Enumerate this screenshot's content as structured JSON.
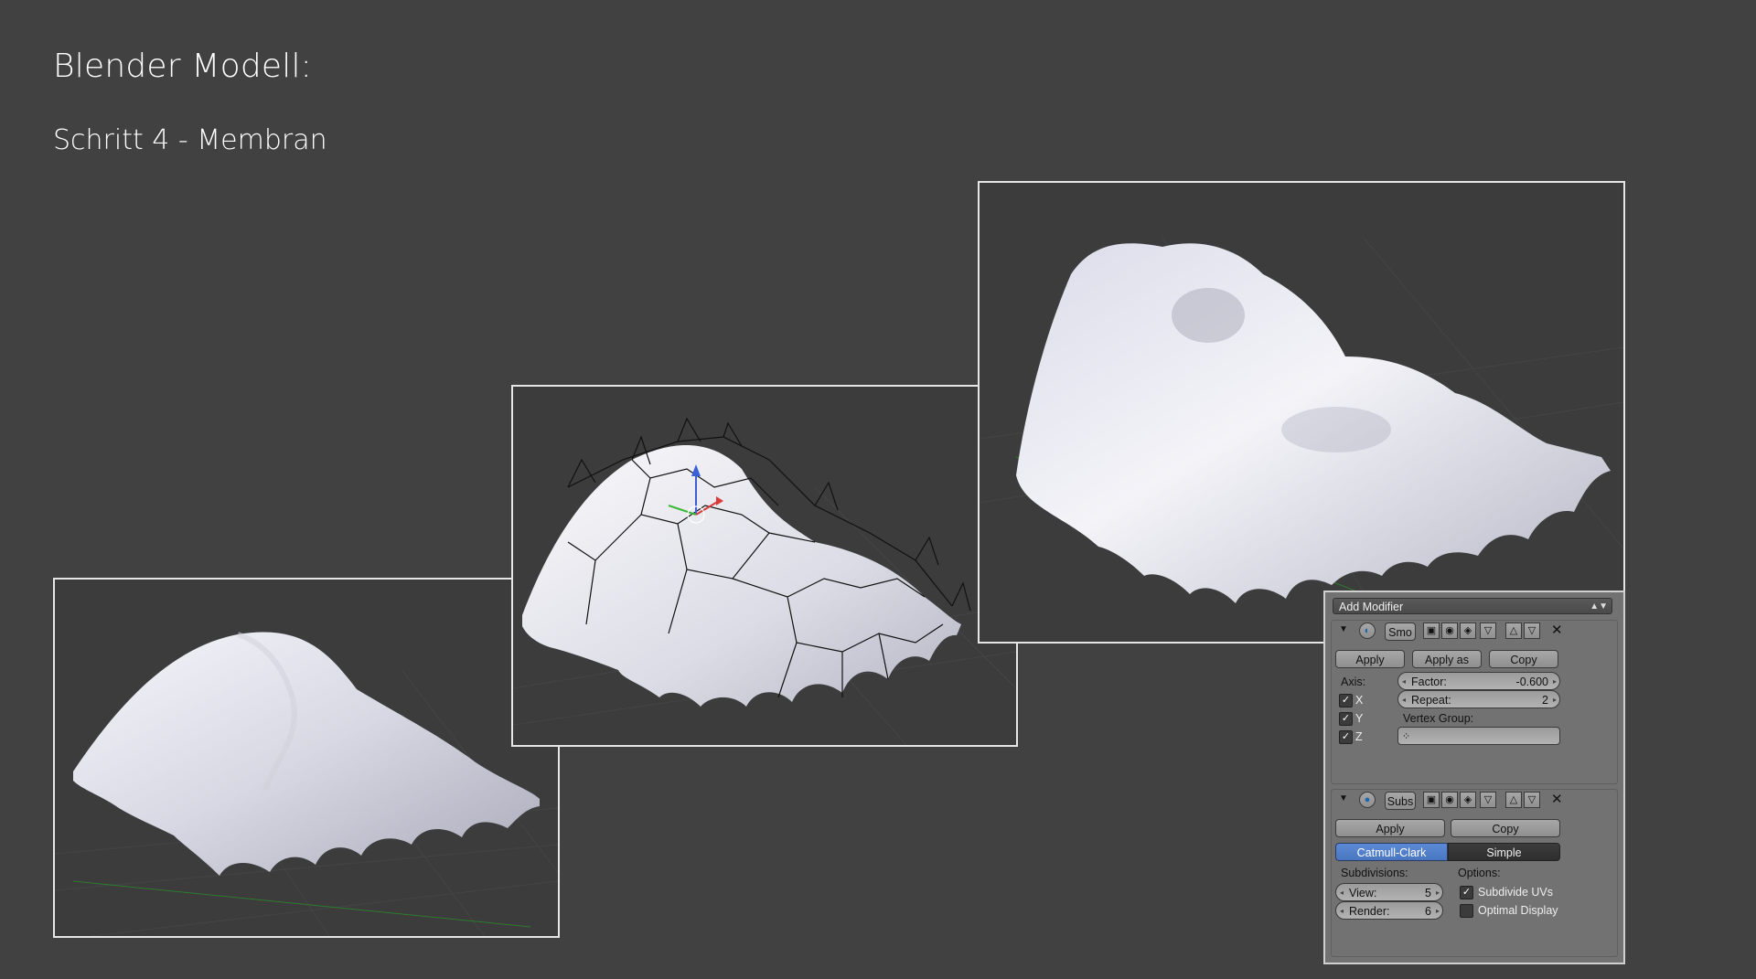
{
  "page": {
    "title": "Blender Modell:",
    "subtitle": "Schritt 4 - Membran"
  },
  "modifier_panel": {
    "add_modifier": "Add Modifier",
    "smooth": {
      "name": "Smo",
      "apply": "Apply",
      "apply_shape": "Apply as Sha...",
      "copy": "Copy",
      "axis_label": "Axis:",
      "axis_x": "X",
      "axis_y": "Y",
      "axis_z": "Z",
      "factor_label": "Factor:",
      "factor_value": "-0.600",
      "repeat_label": "Repeat:",
      "repeat_value": "2",
      "vertex_group_label": "Vertex Group:"
    },
    "subsurf": {
      "name": "Subs",
      "apply": "Apply",
      "copy": "Copy",
      "mode_catmull": "Catmull-Clark",
      "mode_simple": "Simple",
      "subdivisions_label": "Subdivisions:",
      "options_label": "Options:",
      "view_label": "View:",
      "view_value": "5",
      "render_label": "Render:",
      "render_value": "6",
      "subdivide_uvs": "Subdivide UVs",
      "optimal_display": "Optimal Display"
    }
  },
  "colors": {
    "background": "#414141",
    "viewport": "#3c3c3c",
    "active_mode": "#5c8ad6",
    "mesh": "#e4e4ec"
  }
}
